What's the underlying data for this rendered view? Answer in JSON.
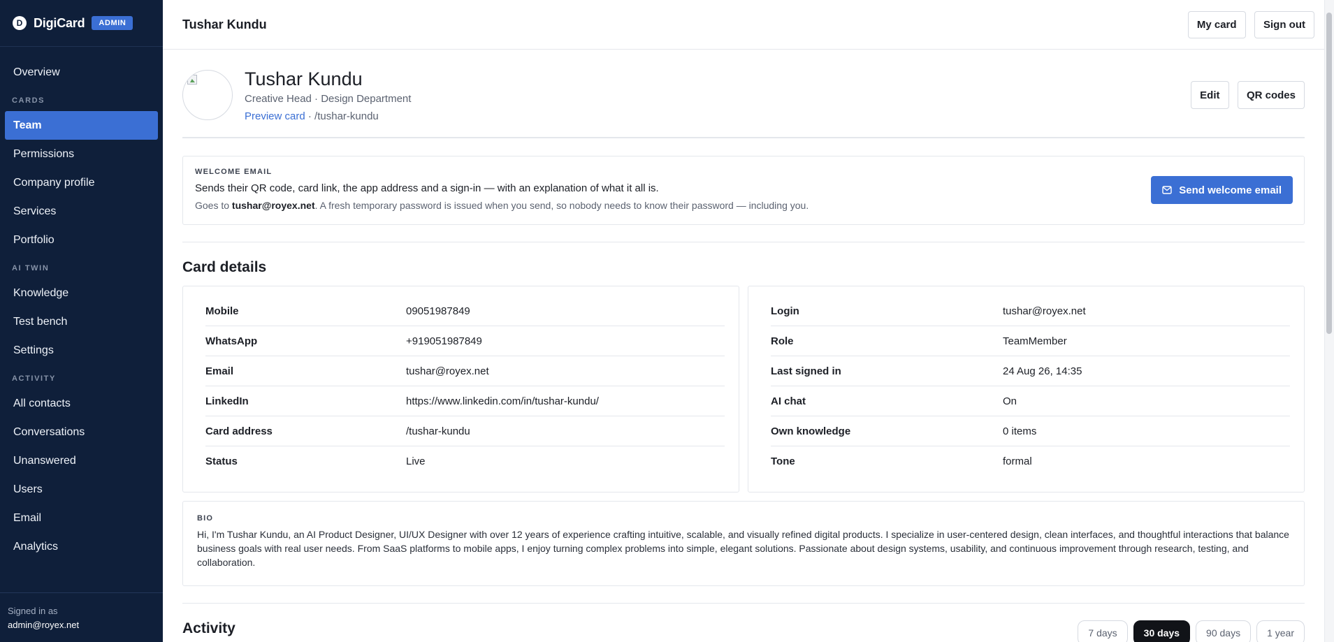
{
  "brand": {
    "name": "DigiCard",
    "badge": "ADMIN",
    "logo_letter": "D"
  },
  "sidebar": {
    "overview": "Overview",
    "sections": {
      "cards": "CARDS",
      "ai_twin": "AI TWIN",
      "activity": "ACTIVITY"
    },
    "cards_items": [
      "Team",
      "Permissions",
      "Company profile",
      "Services",
      "Portfolio"
    ],
    "ai_items": [
      "Knowledge",
      "Test bench",
      "Settings"
    ],
    "activity_items": [
      "All contacts",
      "Conversations",
      "Unanswered",
      "Users",
      "Email",
      "Analytics"
    ],
    "signed_in_label": "Signed in as",
    "signed_in_email": "admin@royex.net"
  },
  "topbar": {
    "title": "Tushar Kundu",
    "my_card": "My card",
    "sign_out": "Sign out"
  },
  "profile": {
    "name": "Tushar Kundu",
    "role": "Creative Head · Design Department",
    "preview_link": "Preview card",
    "separator": " · ",
    "slug": "/tushar-kundu",
    "edit": "Edit",
    "qr_codes": "QR codes"
  },
  "welcome": {
    "label": "WELCOME EMAIL",
    "description": "Sends their QR code, card link, the app address and a sign-in — with an explanation of what it all is.",
    "goes_to_prefix": "Goes to ",
    "email": "tushar@royex.net",
    "goes_to_suffix": ". A fresh temporary password is issued when you send, so nobody needs to know their password — including you.",
    "send_button": "Send welcome email"
  },
  "card_details": {
    "title": "Card details",
    "left": [
      {
        "key": "Mobile",
        "value": "09051987849"
      },
      {
        "key": "WhatsApp",
        "value": "+919051987849"
      },
      {
        "key": "Email",
        "value": "tushar@royex.net"
      },
      {
        "key": "LinkedIn",
        "value": "https://www.linkedin.com/in/tushar-kundu/"
      },
      {
        "key": "Card address",
        "value": "/tushar-kundu"
      },
      {
        "key": "Status",
        "value": "Live"
      }
    ],
    "right": [
      {
        "key": "Login",
        "value": "tushar@royex.net"
      },
      {
        "key": "Role",
        "value": "TeamMember"
      },
      {
        "key": "Last signed in",
        "value": "24 Aug 26, 14:35"
      },
      {
        "key": "AI chat",
        "value": "On"
      },
      {
        "key": "Own knowledge",
        "value": "0 items"
      },
      {
        "key": "Tone",
        "value": "formal"
      }
    ]
  },
  "bio": {
    "label": "BIO",
    "text": "Hi, I'm Tushar Kundu, an AI Product Designer, UI/UX Designer with over 12 years of experience crafting intuitive, scalable, and visually refined digital products. I specialize in user-centered design, clean interfaces, and thoughtful interactions that balance business goals with real user needs. From SaaS platforms to mobile apps, I enjoy turning complex problems into simple, elegant solutions. Passionate about design systems, usability, and continuous improvement through research, testing, and collaboration."
  },
  "activity": {
    "title": "Activity",
    "ranges": [
      "7 days",
      "30 days",
      "90 days",
      "1 year"
    ],
    "active_range": "30 days"
  },
  "colors": {
    "sidebar_bg": "#0f1f3a",
    "accent": "#3b6fd4",
    "active_range_bg": "#111318"
  }
}
